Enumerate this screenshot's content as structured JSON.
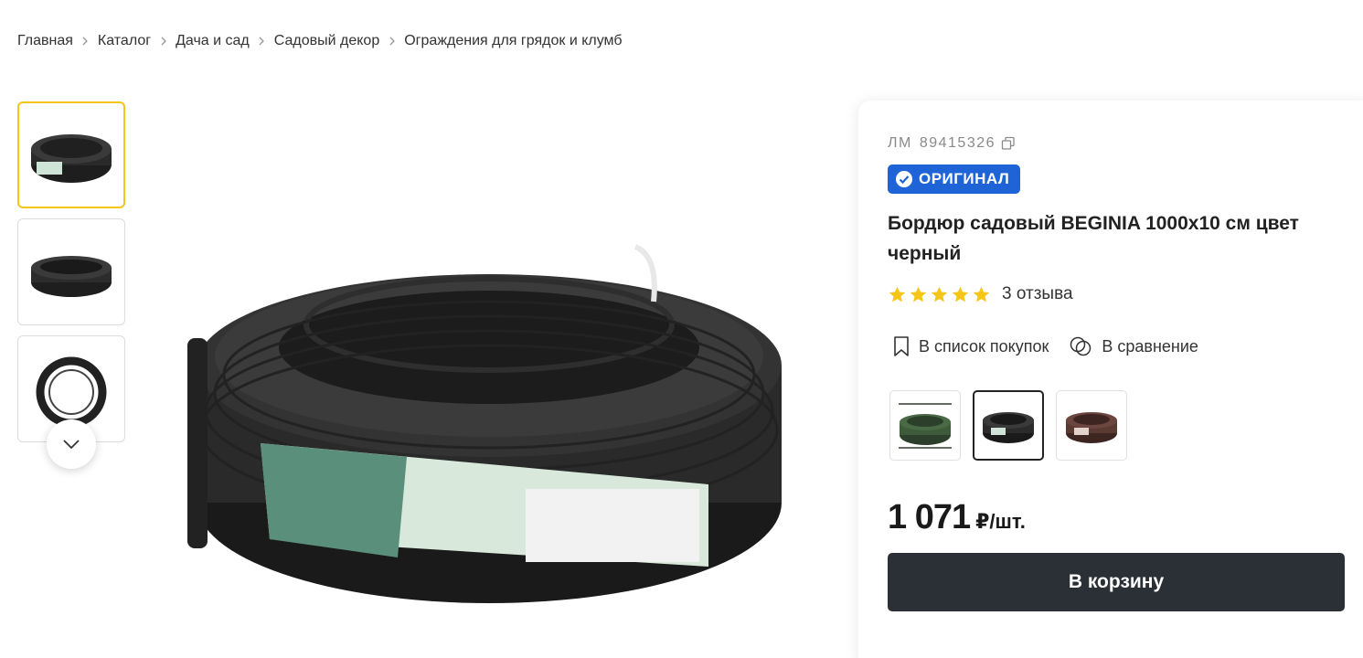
{
  "breadcrumb": [
    "Главная",
    "Каталог",
    "Дача и сад",
    "Садовый декор",
    "Ограждения для грядок и клумб"
  ],
  "product": {
    "sku_label": "ЛМ",
    "sku": "89415326",
    "badge": "ОРИГИНАЛ",
    "title": "Бордюр садовый BEGINIA 1000х10 см цвет черный",
    "rating": 5,
    "reviews": "3 отзыва",
    "price": "1 071",
    "price_unit": "₽/шт.",
    "cart_button": "В корзину"
  },
  "actions": {
    "shopping_list": "В список покупок",
    "compare": "В сравнение"
  },
  "variants": [
    {
      "color_name": "green",
      "color": "#3d5a3a"
    },
    {
      "color_name": "black",
      "color": "#2b2b2b"
    },
    {
      "color_name": "brown",
      "color": "#5a3a33"
    }
  ],
  "colors": {
    "accent_yellow": "#f5c518",
    "badge_blue": "#1f64d6",
    "button_dark": "#2a3035",
    "star": "#f5c518"
  },
  "icons": [
    "chevron-right-icon",
    "chevron-down-icon",
    "copy-icon",
    "check-circle-icon",
    "star-icon",
    "bookmark-icon",
    "compare-icon"
  ]
}
